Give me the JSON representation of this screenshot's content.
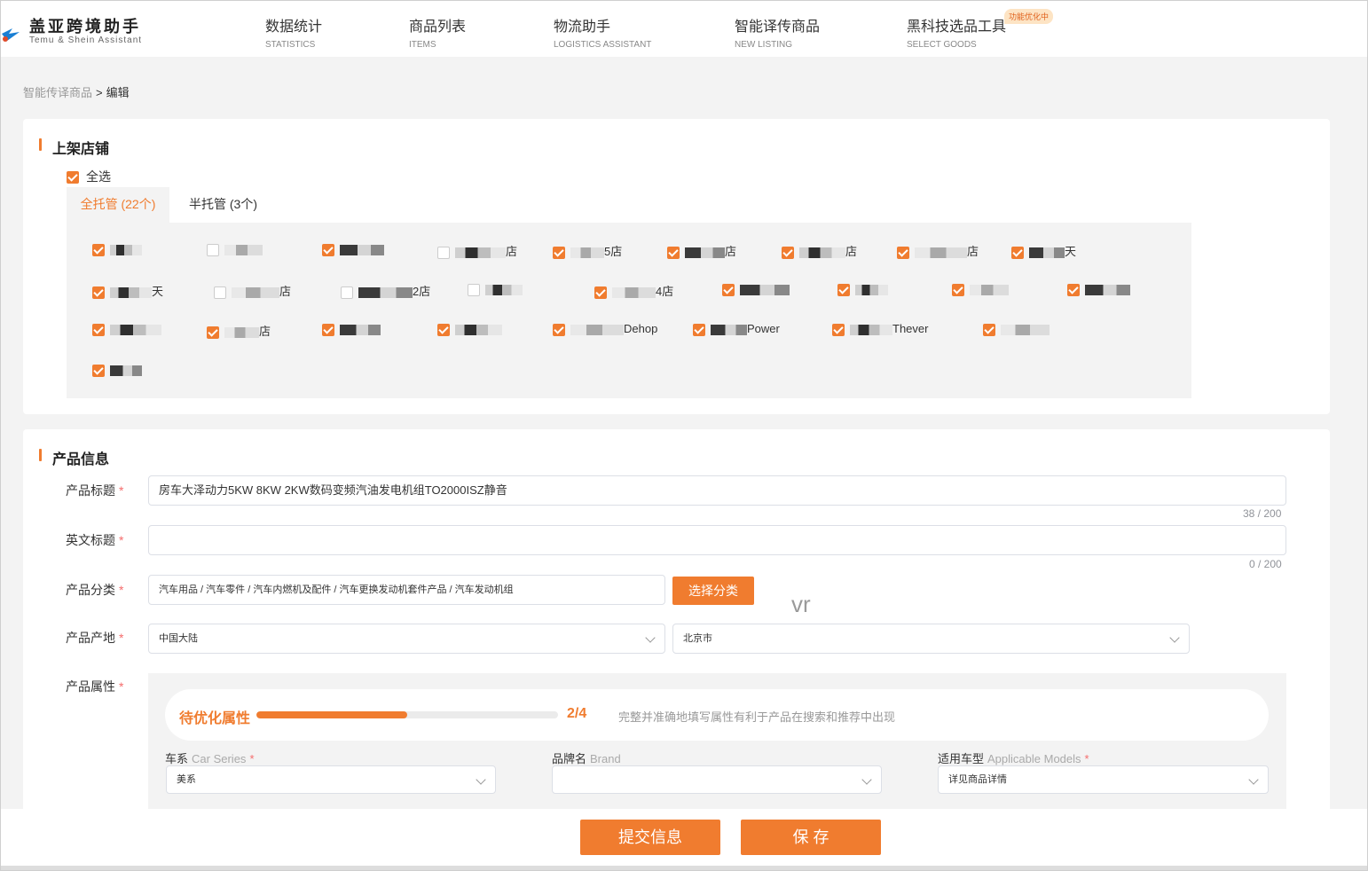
{
  "header": {
    "logo_cn": "盖亚跨境助手",
    "logo_en": "Temu & Shein Assistant",
    "nav": [
      {
        "cn": "数据统计",
        "en": "STATISTICS"
      },
      {
        "cn": "商品列表",
        "en": "ITEMS"
      },
      {
        "cn": "物流助手",
        "en": "LOGISTICS ASSISTANT"
      },
      {
        "cn": "智能译传商品",
        "en": "NEW LISTING"
      },
      {
        "cn": "黑科技选品工具",
        "en": "SELECT GOODS",
        "badge": "功能优化中"
      }
    ]
  },
  "breadcrumb": {
    "parent": "智能传译商品",
    "sep": ">",
    "current": "编辑"
  },
  "stores_section": {
    "title": "上架店铺",
    "select_all": "全选",
    "tabs": [
      "全托管 (22个)",
      "半托管 (3个)"
    ],
    "stores": [
      {
        "text": "",
        "checked": true
      },
      {
        "text": "",
        "checked": false
      },
      {
        "text": "",
        "checked": true
      },
      {
        "text": "店",
        "checked": false
      },
      {
        "text": "5店",
        "checked": true
      },
      {
        "text": "店",
        "checked": true
      },
      {
        "text": "店",
        "checked": true
      },
      {
        "text": "店",
        "checked": true
      },
      {
        "text": "天",
        "checked": true
      },
      {
        "text": "天",
        "checked": true
      },
      {
        "text": "店",
        "checked": false
      },
      {
        "text": "2店",
        "checked": false
      },
      {
        "text": "",
        "checked": false
      },
      {
        "text": "4店",
        "checked": true
      },
      {
        "text": "",
        "checked": true
      },
      {
        "text": "",
        "checked": true
      },
      {
        "text": "",
        "checked": true
      },
      {
        "text": "",
        "checked": true
      },
      {
        "text": "",
        "checked": true
      },
      {
        "text": "店",
        "checked": true
      },
      {
        "text": "",
        "checked": true
      },
      {
        "text": "",
        "checked": true
      },
      {
        "text": "Dehop",
        "checked": true
      },
      {
        "text": "Power",
        "checked": true
      },
      {
        "text": "Thever",
        "checked": true
      },
      {
        "text": "",
        "checked": true
      },
      {
        "text": "",
        "checked": true
      }
    ]
  },
  "product_section": {
    "title": "产品信息",
    "title_label": "产品标题",
    "title_value": "房车大泽动力5KW 8KW 2KW数码变频汽油发电机组TO2000ISZ静音",
    "title_count": "38 / 200",
    "en_title_label": "英文标题",
    "en_title_value": "",
    "en_title_count": "0 / 200",
    "category_label": "产品分类",
    "category_value": "汽车用品 / 汽车零件 / 汽车内燃机及配件 / 汽车更换发动机套件产品 / 汽车发动机组",
    "category_button": "选择分类",
    "origin_label": "产品产地",
    "origin_country": "中国大陆",
    "origin_city": "北京市",
    "attr_label": "产品属性",
    "watermark": "vr",
    "attr_panel": {
      "title": "待优化属性",
      "progress": 0.5,
      "count": "2/4",
      "hint": "完整并准确地填写属性有利于产品在搜索和推荐中出现",
      "fields": [
        {
          "cn": "车系",
          "en": "Car Series",
          "required": "*",
          "value": "美系"
        },
        {
          "cn": "品牌名",
          "en": "Brand",
          "required": "",
          "value": ""
        },
        {
          "cn": "适用车型",
          "en": "Applicable Models",
          "required": "*",
          "value": "详见商品详情"
        }
      ]
    }
  },
  "footer": {
    "submit": "提交信息",
    "save": "保 存"
  },
  "colors": {
    "accent": "#f07c2f",
    "required": "#f56c6c",
    "bg": "#f3f3f3"
  }
}
